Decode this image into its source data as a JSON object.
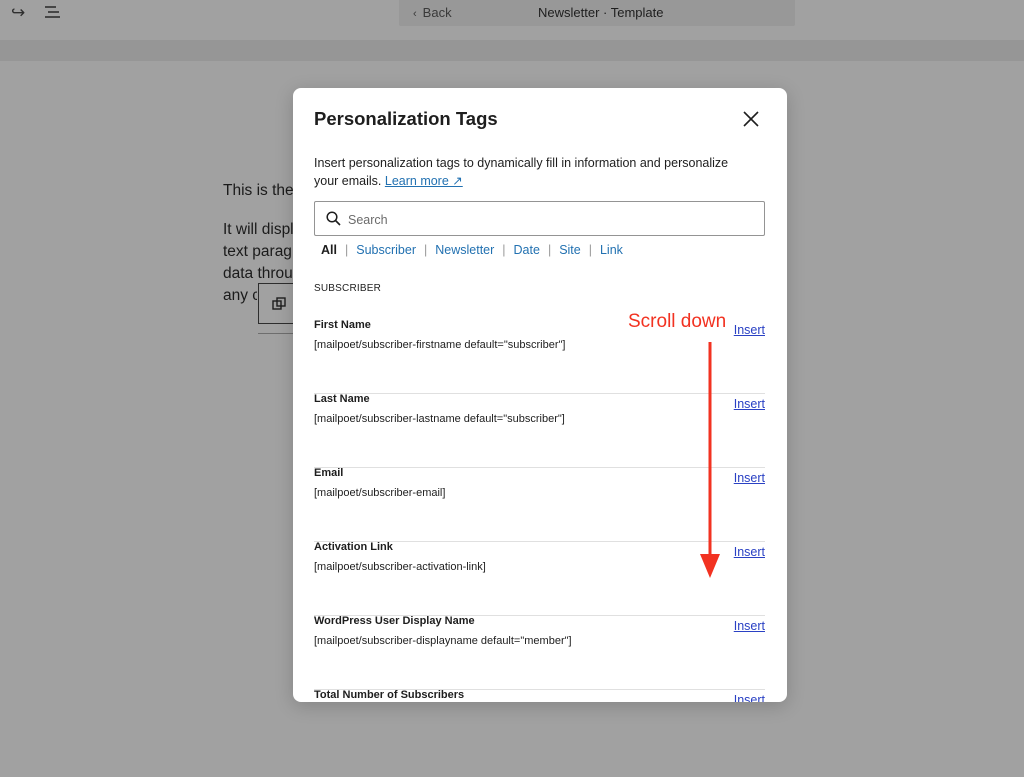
{
  "topbar": {
    "redo_icon": "redo-arrow-icon",
    "list_view_icon": "list-view-icon",
    "back_label": "Back",
    "doc_title": "Newsletter · Template"
  },
  "background_content": {
    "lines": [
      "This is the",
      "It will displ",
      "text parag",
      "data throu",
      "any c"
    ]
  },
  "modal": {
    "title": "Personalization Tags",
    "description": "Insert personalization tags to dynamically fill in information and personalize your emails.",
    "learn_more": "Learn more ↗",
    "search_placeholder": "Search",
    "filters": [
      "All",
      "Subscriber",
      "Newsletter",
      "Date",
      "Site",
      "Link"
    ],
    "active_filter": "All",
    "section_label": "SUBSCRIBER",
    "insert_label": "Insert",
    "tags": [
      {
        "name": "First Name",
        "code": "[mailpoet/subscriber-firstname default=\"subscriber\"]"
      },
      {
        "name": "Last Name",
        "code": "[mailpoet/subscriber-lastname default=\"subscriber\"]"
      },
      {
        "name": "Email",
        "code": "[mailpoet/subscriber-email]"
      },
      {
        "name": "Activation Link",
        "code": "[mailpoet/subscriber-activation-link]"
      },
      {
        "name": "WordPress User Display Name",
        "code": "[mailpoet/subscriber-displayname default=\"member\"]"
      },
      {
        "name": "Total Number of Subscribers",
        "code": ""
      }
    ]
  },
  "annotation": {
    "text": "Scroll down",
    "color": "#f23221"
  }
}
